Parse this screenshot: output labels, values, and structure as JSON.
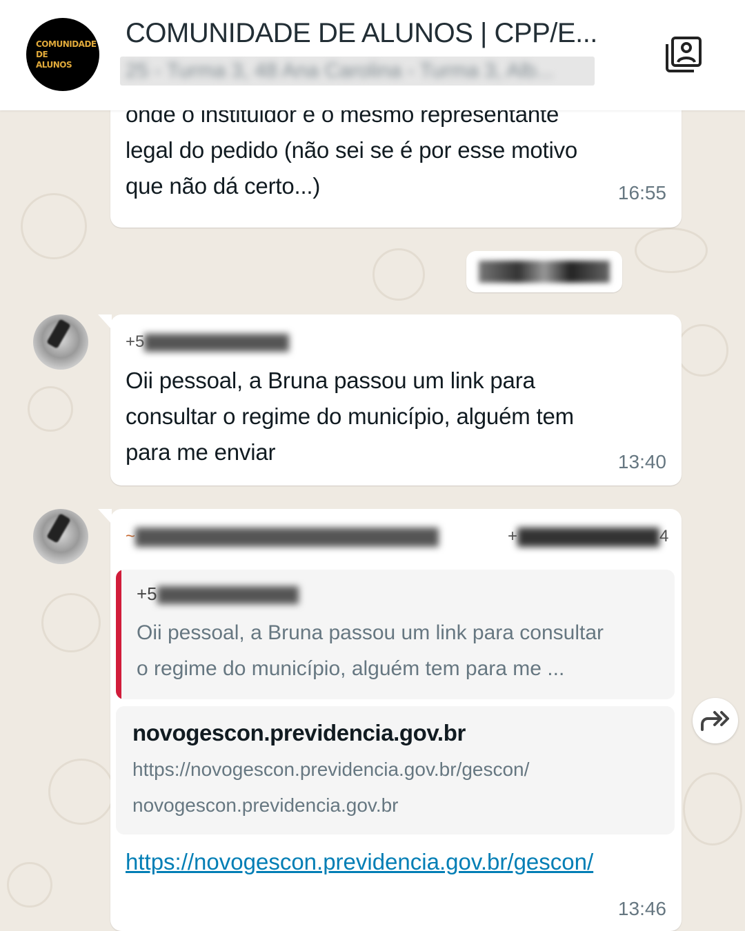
{
  "header": {
    "group_title": "COMUNIDADE DE ALUNOS | CPP/E...",
    "group_subtitle": "25 - Turma 3, 48 Ana Carolina - Turma 3, Alb...",
    "avatar_lines": [
      "COMUNIDADE",
      "DE",
      "ALUNOS"
    ]
  },
  "messages": [
    {
      "text_lines": [
        "onde o instituidor é o mesmo representante",
        "legal do pedido (não sei se é por esse motivo",
        "que não dá certo...)"
      ],
      "time": "16:55"
    },
    {
      "sender_prefix": "+5",
      "text_lines": [
        "Oii pessoal, a Bruna passou um link para",
        "consultar o regime do município, alguém tem",
        "para me enviar"
      ],
      "time": "13:40"
    },
    {
      "sender_name_prefix": "~",
      "sender_phone_prefix": "+",
      "sender_phone_suffix": "4",
      "quote": {
        "author_prefix": "+5",
        "text_lines": [
          "Oii pessoal, a Bruna passou um link para consultar",
          "o regime do município, alguém tem para me ..."
        ]
      },
      "link_preview": {
        "domain": "novogescon.previdencia.gov.br",
        "url": "https://novogescon.previdencia.gov.br/gescon/",
        "site": "novogescon.previdencia.gov.br"
      },
      "link_text": "https://novogescon.previdencia.gov.br/gescon/",
      "time": "13:46"
    }
  ],
  "colors": {
    "background": "#efeae2",
    "bubble": "#ffffff",
    "link": "#027eb5",
    "quote_bar": "#d11c3a",
    "meta_text": "#667781"
  }
}
